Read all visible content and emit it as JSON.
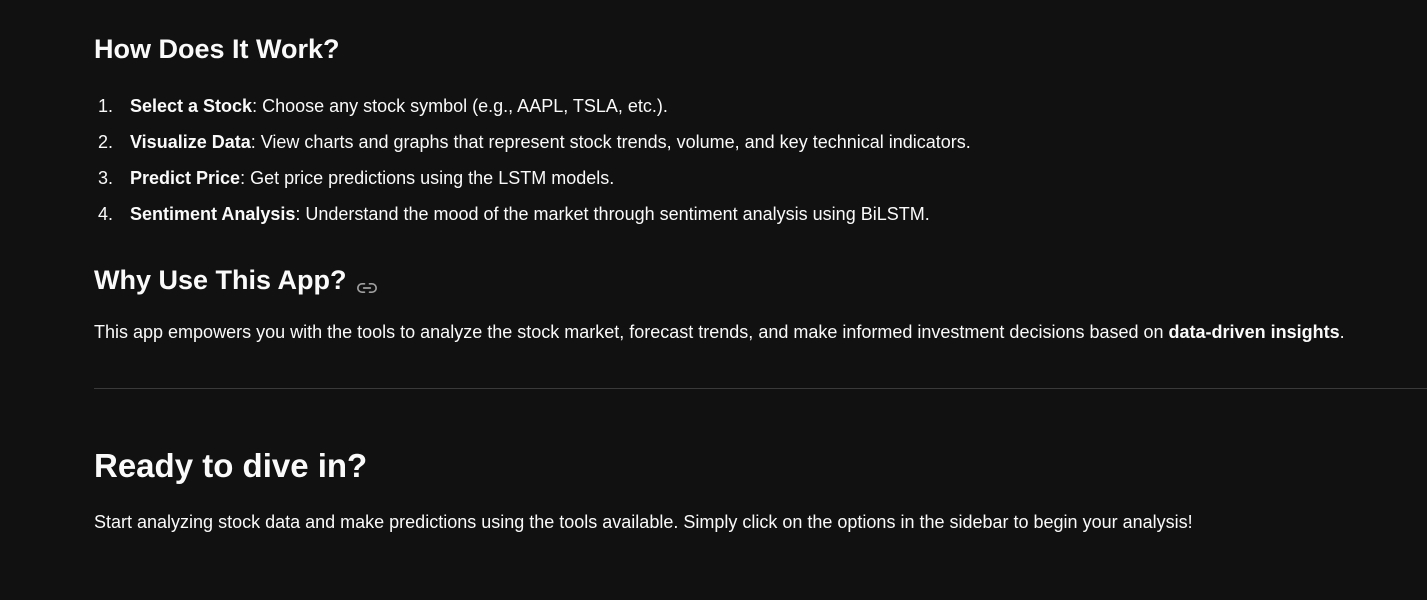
{
  "how_section": {
    "heading": "How Does It Work?",
    "steps": [
      {
        "number": "1.",
        "title": "Select a Stock",
        "text": ": Choose any stock symbol (e.g., AAPL, TSLA, etc.)."
      },
      {
        "number": "2.",
        "title": "Visualize Data",
        "text": ": View charts and graphs that represent stock trends, volume, and key technical indicators."
      },
      {
        "number": "3.",
        "title": "Predict Price",
        "text": ": Get price predictions using the LSTM models."
      },
      {
        "number": "4.",
        "title": "Sentiment Analysis",
        "text": ": Understand the mood of the market through sentiment analysis using BiLSTM."
      }
    ]
  },
  "why_section": {
    "heading": "Why Use This App?",
    "anchor_icon": "link-icon",
    "paragraph_start": "This app empowers you with the tools to analyze the stock market, forecast trends, and make informed investment decisions based on ",
    "paragraph_bold": "data-driven insights",
    "paragraph_end": "."
  },
  "ready_section": {
    "heading": "Ready to dive in?",
    "paragraph": "Start analyzing stock data and make predictions using the tools available. Simply click on the options in the sidebar to begin your analysis!"
  },
  "colors": {
    "background": "#111111",
    "text": "#fafafa",
    "divider": "#3a3a3a",
    "icon": "#a0a0a0"
  }
}
